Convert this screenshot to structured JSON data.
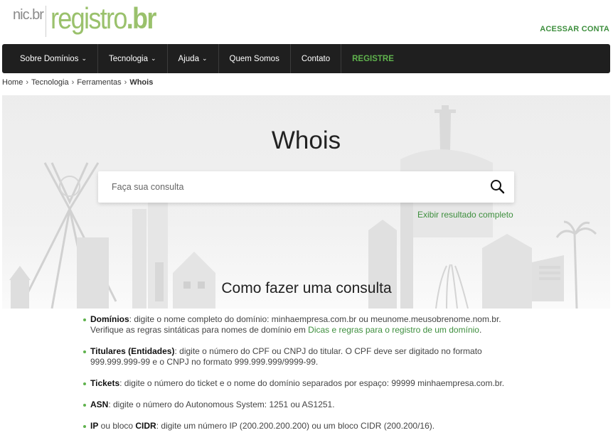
{
  "header": {
    "logo_nic": "nic.br",
    "logo_registro": "registro",
    "logo_br": ".br",
    "account_link": "ACESSAR CONTA"
  },
  "nav": {
    "items": [
      {
        "label": "Sobre Domínios",
        "dropdown": true
      },
      {
        "label": "Tecnologia",
        "dropdown": true
      },
      {
        "label": "Ajuda",
        "dropdown": true
      },
      {
        "label": "Quem Somos",
        "dropdown": false
      },
      {
        "label": "Contato",
        "dropdown": false
      },
      {
        "label": "REGISTRE",
        "dropdown": false
      }
    ],
    "chevron": "⌄"
  },
  "breadcrumb": {
    "items": [
      "Home",
      "Tecnologia",
      "Ferramentas"
    ],
    "current": "Whois",
    "separator": "›"
  },
  "hero": {
    "title": "Whois",
    "search_placeholder": "Faça sua consulta",
    "search_value": "",
    "search_icon": "search-icon",
    "full_result_link": "Exibir resultado completo"
  },
  "howto": {
    "title": "Como fazer uma consulta",
    "items": [
      {
        "term": "Domínios",
        "text": ": digite o nome completo do domínio: minhaempresa.com.br ou meunome.meusobrenome.nom.br. Verifique as regras sintáticas para nomes de domínio em ",
        "link": "Dicas e regras para o registro de um domínio",
        "tail": "."
      },
      {
        "term": "Titulares (Entidades)",
        "text": ": digite o número do CPF ou CNPJ do titular. O CPF deve ser digitado no formato 999.999.999-99 e o CNPJ no formato 999.999.999/9999-99."
      },
      {
        "term": "Tickets",
        "text": ": digite o número do ticket e o nome do domínio separados por espaço: 99999 minhaempresa.com.br."
      },
      {
        "term": "ASN",
        "text": ": digite o número do Autonomous System: 1251 ou AS1251."
      },
      {
        "term": "IP",
        "mid": " ou bloco ",
        "term2": "CIDR",
        "text": ": digite um número IP (200.200.200.200) ou um bloco CIDR (200.200/16)."
      }
    ]
  },
  "colors": {
    "brand_green": "#9ac16c",
    "link_green": "#3e8f3e",
    "navbar_bg": "#1f1f1f",
    "register_green": "#5fb24d"
  }
}
